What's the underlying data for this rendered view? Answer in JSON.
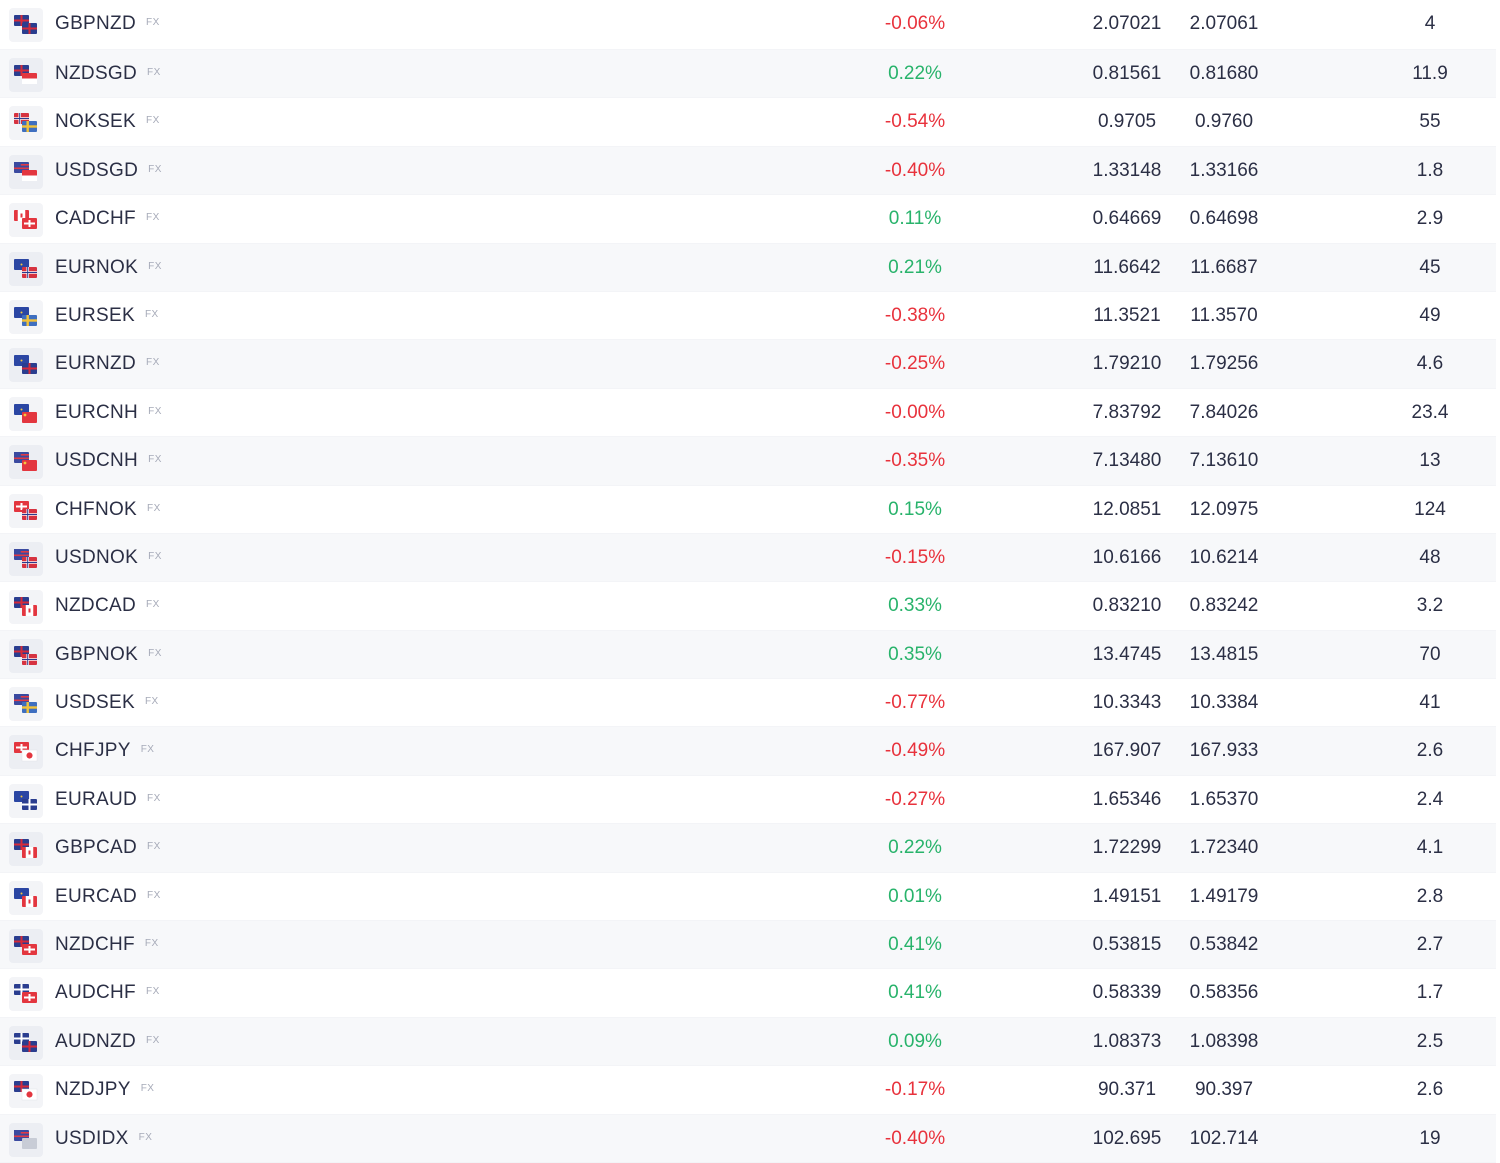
{
  "colors": {
    "negative": "#e8323c",
    "positive": "#28b36b",
    "text": "#2b2f45",
    "row_alt": "#f7f8fa"
  },
  "rows": [
    {
      "symbol": "GBPNZD",
      "tag": "FX",
      "change": "-0.06%",
      "bid": "2.07021",
      "ask": "2.07061",
      "spread": "4",
      "dir": "neg",
      "flags": [
        "gb",
        "nz"
      ]
    },
    {
      "symbol": "NZDSGD",
      "tag": "FX",
      "change": "0.22%",
      "bid": "0.81561",
      "ask": "0.81680",
      "spread": "11.9",
      "dir": "pos",
      "flags": [
        "nz",
        "sg"
      ]
    },
    {
      "symbol": "NOKSEK",
      "tag": "FX",
      "change": "-0.54%",
      "bid": "0.9705",
      "ask": "0.9760",
      "spread": "55",
      "dir": "neg",
      "flags": [
        "no",
        "se"
      ]
    },
    {
      "symbol": "USDSGD",
      "tag": "FX",
      "change": "-0.40%",
      "bid": "1.33148",
      "ask": "1.33166",
      "spread": "1.8",
      "dir": "neg",
      "flags": [
        "us",
        "sg"
      ]
    },
    {
      "symbol": "CADCHF",
      "tag": "FX",
      "change": "0.11%",
      "bid": "0.64669",
      "ask": "0.64698",
      "spread": "2.9",
      "dir": "pos",
      "flags": [
        "ca",
        "ch"
      ]
    },
    {
      "symbol": "EURNOK",
      "tag": "FX",
      "change": "0.21%",
      "bid": "11.6642",
      "ask": "11.6687",
      "spread": "45",
      "dir": "pos",
      "flags": [
        "eu",
        "no"
      ]
    },
    {
      "symbol": "EURSEK",
      "tag": "FX",
      "change": "-0.38%",
      "bid": "11.3521",
      "ask": "11.3570",
      "spread": "49",
      "dir": "neg",
      "flags": [
        "eu",
        "se"
      ]
    },
    {
      "symbol": "EURNZD",
      "tag": "FX",
      "change": "-0.25%",
      "bid": "1.79210",
      "ask": "1.79256",
      "spread": "4.6",
      "dir": "neg",
      "flags": [
        "eu",
        "nz"
      ]
    },
    {
      "symbol": "EURCNH",
      "tag": "FX",
      "change": "-0.00%",
      "bid": "7.83792",
      "ask": "7.84026",
      "spread": "23.4",
      "dir": "neg",
      "flags": [
        "eu",
        "cn"
      ]
    },
    {
      "symbol": "USDCNH",
      "tag": "FX",
      "change": "-0.35%",
      "bid": "7.13480",
      "ask": "7.13610",
      "spread": "13",
      "dir": "neg",
      "flags": [
        "us",
        "cn"
      ]
    },
    {
      "symbol": "CHFNOK",
      "tag": "FX",
      "change": "0.15%",
      "bid": "12.0851",
      "ask": "12.0975",
      "spread": "124",
      "dir": "pos",
      "flags": [
        "ch",
        "no"
      ]
    },
    {
      "symbol": "USDNOK",
      "tag": "FX",
      "change": "-0.15%",
      "bid": "10.6166",
      "ask": "10.6214",
      "spread": "48",
      "dir": "neg",
      "flags": [
        "us",
        "no"
      ]
    },
    {
      "symbol": "NZDCAD",
      "tag": "FX",
      "change": "0.33%",
      "bid": "0.83210",
      "ask": "0.83242",
      "spread": "3.2",
      "dir": "pos",
      "flags": [
        "nz",
        "ca"
      ]
    },
    {
      "symbol": "GBPNOK",
      "tag": "FX",
      "change": "0.35%",
      "bid": "13.4745",
      "ask": "13.4815",
      "spread": "70",
      "dir": "pos",
      "flags": [
        "gb",
        "no"
      ]
    },
    {
      "symbol": "USDSEK",
      "tag": "FX",
      "change": "-0.77%",
      "bid": "10.3343",
      "ask": "10.3384",
      "spread": "41",
      "dir": "neg",
      "flags": [
        "us",
        "se"
      ]
    },
    {
      "symbol": "CHFJPY",
      "tag": "FX",
      "change": "-0.49%",
      "bid": "167.907",
      "ask": "167.933",
      "spread": "2.6",
      "dir": "neg",
      "flags": [
        "ch",
        "jp"
      ]
    },
    {
      "symbol": "EURAUD",
      "tag": "FX",
      "change": "-0.27%",
      "bid": "1.65346",
      "ask": "1.65370",
      "spread": "2.4",
      "dir": "neg",
      "flags": [
        "eu",
        "au"
      ]
    },
    {
      "symbol": "GBPCAD",
      "tag": "FX",
      "change": "0.22%",
      "bid": "1.72299",
      "ask": "1.72340",
      "spread": "4.1",
      "dir": "pos",
      "flags": [
        "gb",
        "ca"
      ]
    },
    {
      "symbol": "EURCAD",
      "tag": "FX",
      "change": "0.01%",
      "bid": "1.49151",
      "ask": "1.49179",
      "spread": "2.8",
      "dir": "pos",
      "flags": [
        "eu",
        "ca"
      ]
    },
    {
      "symbol": "NZDCHF",
      "tag": "FX",
      "change": "0.41%",
      "bid": "0.53815",
      "ask": "0.53842",
      "spread": "2.7",
      "dir": "pos",
      "flags": [
        "nz",
        "ch"
      ]
    },
    {
      "symbol": "AUDCHF",
      "tag": "FX",
      "change": "0.41%",
      "bid": "0.58339",
      "ask": "0.58356",
      "spread": "1.7",
      "dir": "pos",
      "flags": [
        "au",
        "ch"
      ]
    },
    {
      "symbol": "AUDNZD",
      "tag": "FX",
      "change": "0.09%",
      "bid": "1.08373",
      "ask": "1.08398",
      "spread": "2.5",
      "dir": "pos",
      "flags": [
        "au",
        "nz"
      ]
    },
    {
      "symbol": "NZDJPY",
      "tag": "FX",
      "change": "-0.17%",
      "bid": "90.371",
      "ask": "90.397",
      "spread": "2.6",
      "dir": "neg",
      "flags": [
        "nz",
        "jp"
      ]
    },
    {
      "symbol": "USDIDX",
      "tag": "FX",
      "change": "-0.40%",
      "bid": "102.695",
      "ask": "102.714",
      "spread": "19",
      "dir": "neg",
      "flags": [
        "us",
        "idx"
      ]
    }
  ]
}
